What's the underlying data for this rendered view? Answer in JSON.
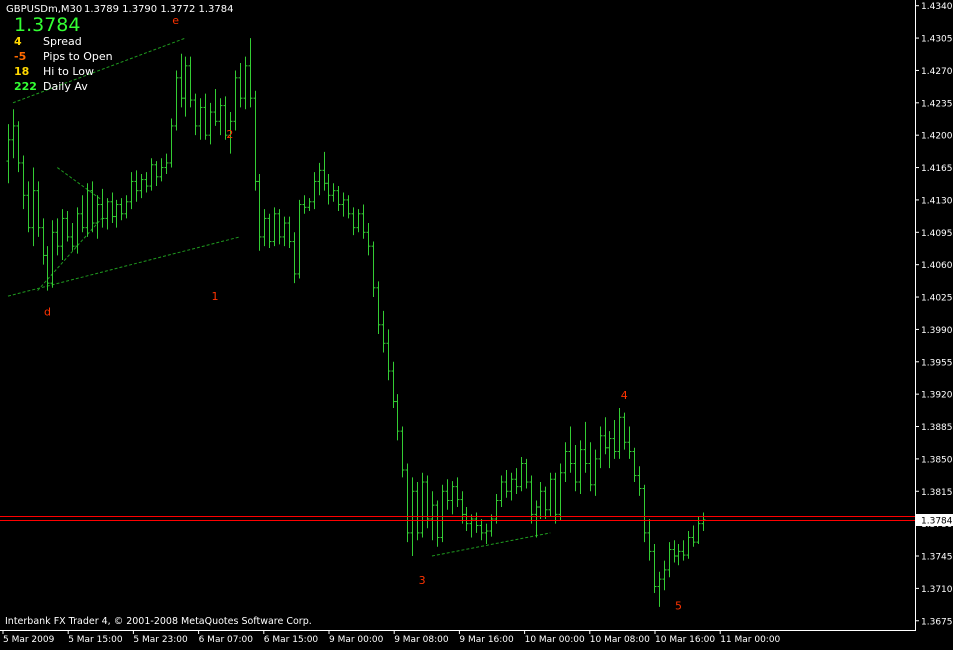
{
  "header": {
    "symbol_line": "GBPUSDm,M30",
    "ohlc": "1.3789 1.3790 1.3772 1.3784"
  },
  "info_panel": {
    "price": "1.3784",
    "rows": [
      {
        "value": "4",
        "label": "Spread",
        "color": "#ffd700"
      },
      {
        "value": "-5",
        "label": "Pips to Open",
        "color": "#ff6a00"
      },
      {
        "value": "18",
        "label": "Hi to Low",
        "color": "#ffd700"
      },
      {
        "value": "222",
        "label": "Daily Av",
        "color": "#33ff33"
      }
    ]
  },
  "copyright": "Interbank FX Trader 4, © 2001-2008 MetaQuotes Software Corp.",
  "colors": {
    "background": "#000000",
    "bars": "#33cc33",
    "axis": "#ffffff",
    "current_price_line": "#ff0000",
    "trendlines": "#1f9a1f",
    "wave_labels": "#ff3300",
    "price_big": "#33ff33"
  },
  "chart_data": {
    "type": "ohlc",
    "symbol": "GBPUSDm",
    "timeframe": "M30",
    "y_ticks": [
      "1.4340",
      "1.4305",
      "1.4270",
      "1.4235",
      "1.4200",
      "1.4165",
      "1.4130",
      "1.4095",
      "1.4060",
      "1.4025",
      "1.3990",
      "1.3955",
      "1.3920",
      "1.3885",
      "1.3850",
      "1.3815",
      "1.3780",
      "1.3745",
      "1.3710",
      "1.3675"
    ],
    "ylim": [
      1.3665,
      1.4344
    ],
    "x_ticks": [
      "5 Mar 2009",
      "5 Mar 15:00",
      "5 Mar 23:00",
      "6 Mar 07:00",
      "6 Mar 15:00",
      "9 Mar 00:00",
      "9 Mar 08:00",
      "9 Mar 16:00",
      "10 Mar 00:00",
      "10 Mar 08:00",
      "10 Mar 16:00",
      "11 Mar 00:00"
    ],
    "current_price": 1.3784,
    "current_price_label": "1.3784",
    "bars": [
      {
        "o": 1.4172,
        "h": 1.4212,
        "l": 1.4148,
        "c": 1.4195
      },
      {
        "o": 1.4195,
        "h": 1.4228,
        "l": 1.4175,
        "c": 1.421
      },
      {
        "o": 1.421,
        "h": 1.4215,
        "l": 1.416,
        "c": 1.417
      },
      {
        "o": 1.417,
        "h": 1.4178,
        "l": 1.412,
        "c": 1.4135
      },
      {
        "o": 1.4135,
        "h": 1.415,
        "l": 1.4095,
        "c": 1.41
      },
      {
        "o": 1.41,
        "h": 1.4165,
        "l": 1.408,
        "c": 1.414
      },
      {
        "o": 1.414,
        "h": 1.415,
        "l": 1.409,
        "c": 1.41
      },
      {
        "o": 1.41,
        "h": 1.411,
        "l": 1.406,
        "c": 1.407
      },
      {
        "o": 1.407,
        "h": 1.408,
        "l": 1.4032,
        "c": 1.404
      },
      {
        "o": 1.404,
        "h": 1.4108,
        "l": 1.4035,
        "c": 1.4095
      },
      {
        "o": 1.4095,
        "h": 1.411,
        "l": 1.407,
        "c": 1.408
      },
      {
        "o": 1.408,
        "h": 1.412,
        "l": 1.4065,
        "c": 1.411
      },
      {
        "o": 1.411,
        "h": 1.4118,
        "l": 1.4085,
        "c": 1.409
      },
      {
        "o": 1.409,
        "h": 1.4105,
        "l": 1.4075,
        "c": 1.408
      },
      {
        "o": 1.408,
        "h": 1.4122,
        "l": 1.4072,
        "c": 1.4115
      },
      {
        "o": 1.4115,
        "h": 1.4135,
        "l": 1.4095,
        "c": 1.41
      },
      {
        "o": 1.41,
        "h": 1.4148,
        "l": 1.409,
        "c": 1.414
      },
      {
        "o": 1.414,
        "h": 1.415,
        "l": 1.4095,
        "c": 1.4105
      },
      {
        "o": 1.4105,
        "h": 1.4135,
        "l": 1.4088,
        "c": 1.4125
      },
      {
        "o": 1.4125,
        "h": 1.4142,
        "l": 1.41,
        "c": 1.411
      },
      {
        "o": 1.411,
        "h": 1.4132,
        "l": 1.4098,
        "c": 1.4128
      },
      {
        "o": 1.4128,
        "h": 1.4138,
        "l": 1.4105,
        "c": 1.4112
      },
      {
        "o": 1.4112,
        "h": 1.413,
        "l": 1.41,
        "c": 1.4125
      },
      {
        "o": 1.4125,
        "h": 1.4132,
        "l": 1.4108,
        "c": 1.4115
      },
      {
        "o": 1.4115,
        "h": 1.4135,
        "l": 1.411,
        "c": 1.4128
      },
      {
        "o": 1.4128,
        "h": 1.416,
        "l": 1.412,
        "c": 1.415
      },
      {
        "o": 1.415,
        "h": 1.4162,
        "l": 1.4128,
        "c": 1.414
      },
      {
        "o": 1.414,
        "h": 1.4158,
        "l": 1.4132,
        "c": 1.4152
      },
      {
        "o": 1.4152,
        "h": 1.416,
        "l": 1.4138,
        "c": 1.4145
      },
      {
        "o": 1.4145,
        "h": 1.4175,
        "l": 1.414,
        "c": 1.4168
      },
      {
        "o": 1.4168,
        "h": 1.4172,
        "l": 1.4145,
        "c": 1.4155
      },
      {
        "o": 1.4155,
        "h": 1.4175,
        "l": 1.415,
        "c": 1.4165
      },
      {
        "o": 1.4165,
        "h": 1.418,
        "l": 1.4158,
        "c": 1.417
      },
      {
        "o": 1.417,
        "h": 1.4218,
        "l": 1.4165,
        "c": 1.421
      },
      {
        "o": 1.421,
        "h": 1.427,
        "l": 1.4205,
        "c": 1.4262
      },
      {
        "o": 1.4262,
        "h": 1.4288,
        "l": 1.423,
        "c": 1.424
      },
      {
        "o": 1.424,
        "h": 1.4285,
        "l": 1.422,
        "c": 1.4275
      },
      {
        "o": 1.4275,
        "h": 1.4285,
        "l": 1.423,
        "c": 1.4238
      },
      {
        "o": 1.4238,
        "h": 1.4245,
        "l": 1.42,
        "c": 1.421
      },
      {
        "o": 1.421,
        "h": 1.424,
        "l": 1.4195,
        "c": 1.423
      },
      {
        "o": 1.423,
        "h": 1.4245,
        "l": 1.4195,
        "c": 1.42
      },
      {
        "o": 1.42,
        "h": 1.4235,
        "l": 1.419,
        "c": 1.4225
      },
      {
        "o": 1.4225,
        "h": 1.425,
        "l": 1.421,
        "c": 1.4215
      },
      {
        "o": 1.4215,
        "h": 1.424,
        "l": 1.42,
        "c": 1.4232
      },
      {
        "o": 1.4232,
        "h": 1.4242,
        "l": 1.4195,
        "c": 1.42
      },
      {
        "o": 1.42,
        "h": 1.4225,
        "l": 1.418,
        "c": 1.4215
      },
      {
        "o": 1.4215,
        "h": 1.427,
        "l": 1.4205,
        "c": 1.4262
      },
      {
        "o": 1.4262,
        "h": 1.4278,
        "l": 1.423,
        "c": 1.424
      },
      {
        "o": 1.424,
        "h": 1.4285,
        "l": 1.4228,
        "c": 1.4275
      },
      {
        "o": 1.4275,
        "h": 1.4305,
        "l": 1.423,
        "c": 1.424
      },
      {
        "o": 1.424,
        "h": 1.4248,
        "l": 1.414,
        "c": 1.415
      },
      {
        "o": 1.415,
        "h": 1.4158,
        "l": 1.4075,
        "c": 1.409
      },
      {
        "o": 1.409,
        "h": 1.412,
        "l": 1.408,
        "c": 1.411
      },
      {
        "o": 1.411,
        "h": 1.4115,
        "l": 1.4078,
        "c": 1.4085
      },
      {
        "o": 1.4085,
        "h": 1.4122,
        "l": 1.408,
        "c": 1.4115
      },
      {
        "o": 1.4115,
        "h": 1.412,
        "l": 1.4082,
        "c": 1.409
      },
      {
        "o": 1.409,
        "h": 1.4112,
        "l": 1.408,
        "c": 1.4105
      },
      {
        "o": 1.4105,
        "h": 1.4112,
        "l": 1.4078,
        "c": 1.4085
      },
      {
        "o": 1.4085,
        "h": 1.4095,
        "l": 1.404,
        "c": 1.405
      },
      {
        "o": 1.405,
        "h": 1.413,
        "l": 1.4045,
        "c": 1.4125
      },
      {
        "o": 1.4125,
        "h": 1.4135,
        "l": 1.4115,
        "c": 1.4122
      },
      {
        "o": 1.4122,
        "h": 1.4132,
        "l": 1.4118,
        "c": 1.4128
      },
      {
        "o": 1.4128,
        "h": 1.416,
        "l": 1.412,
        "c": 1.415
      },
      {
        "o": 1.415,
        "h": 1.417,
        "l": 1.4135,
        "c": 1.4162
      },
      {
        "o": 1.4162,
        "h": 1.4182,
        "l": 1.414,
        "c": 1.4148
      },
      {
        "o": 1.4148,
        "h": 1.4158,
        "l": 1.4125,
        "c": 1.4135
      },
      {
        "o": 1.4135,
        "h": 1.4148,
        "l": 1.4128,
        "c": 1.414
      },
      {
        "o": 1.414,
        "h": 1.4145,
        "l": 1.4118,
        "c": 1.4125
      },
      {
        "o": 1.4125,
        "h": 1.4138,
        "l": 1.4112,
        "c": 1.413
      },
      {
        "o": 1.413,
        "h": 1.4135,
        "l": 1.411,
        "c": 1.4115
      },
      {
        "o": 1.4115,
        "h": 1.4122,
        "l": 1.4092,
        "c": 1.41
      },
      {
        "o": 1.41,
        "h": 1.412,
        "l": 1.4095,
        "c": 1.4115
      },
      {
        "o": 1.4115,
        "h": 1.4125,
        "l": 1.4088,
        "c": 1.4095
      },
      {
        "o": 1.4095,
        "h": 1.4105,
        "l": 1.407,
        "c": 1.408
      },
      {
        "o": 1.408,
        "h": 1.4085,
        "l": 1.4025,
        "c": 1.4035
      },
      {
        "o": 1.4035,
        "h": 1.4042,
        "l": 1.3985,
        "c": 1.3995
      },
      {
        "o": 1.3995,
        "h": 1.401,
        "l": 1.3965,
        "c": 1.3975
      },
      {
        "o": 1.3975,
        "h": 1.399,
        "l": 1.3935,
        "c": 1.3945
      },
      {
        "o": 1.3945,
        "h": 1.3955,
        "l": 1.3905,
        "c": 1.3912
      },
      {
        "o": 1.3912,
        "h": 1.392,
        "l": 1.387,
        "c": 1.388
      },
      {
        "o": 1.388,
        "h": 1.3885,
        "l": 1.383,
        "c": 1.3838
      },
      {
        "o": 1.3838,
        "h": 1.3845,
        "l": 1.376,
        "c": 1.377
      },
      {
        "o": 1.377,
        "h": 1.383,
        "l": 1.3745,
        "c": 1.3815
      },
      {
        "o": 1.3815,
        "h": 1.3825,
        "l": 1.3762,
        "c": 1.377
      },
      {
        "o": 1.377,
        "h": 1.3835,
        "l": 1.3765,
        "c": 1.3825
      },
      {
        "o": 1.3825,
        "h": 1.3832,
        "l": 1.3775,
        "c": 1.3785
      },
      {
        "o": 1.3785,
        "h": 1.3815,
        "l": 1.3762,
        "c": 1.38
      },
      {
        "o": 1.38,
        "h": 1.3805,
        "l": 1.3755,
        "c": 1.3765
      },
      {
        "o": 1.3765,
        "h": 1.3822,
        "l": 1.376,
        "c": 1.3815
      },
      {
        "o": 1.3815,
        "h": 1.3828,
        "l": 1.3795,
        "c": 1.3805
      },
      {
        "o": 1.3805,
        "h": 1.3826,
        "l": 1.379,
        "c": 1.382
      },
      {
        "o": 1.382,
        "h": 1.383,
        "l": 1.3798,
        "c": 1.3806
      },
      {
        "o": 1.3806,
        "h": 1.3815,
        "l": 1.378,
        "c": 1.379
      },
      {
        "o": 1.379,
        "h": 1.3798,
        "l": 1.3772,
        "c": 1.378
      },
      {
        "o": 1.378,
        "h": 1.379,
        "l": 1.3765,
        "c": 1.3785
      },
      {
        "o": 1.3785,
        "h": 1.3792,
        "l": 1.377,
        "c": 1.3778
      },
      {
        "o": 1.3778,
        "h": 1.3785,
        "l": 1.3762,
        "c": 1.377
      },
      {
        "o": 1.377,
        "h": 1.378,
        "l": 1.3758,
        "c": 1.3772
      },
      {
        "o": 1.3772,
        "h": 1.379,
        "l": 1.3766,
        "c": 1.3785
      },
      {
        "o": 1.3785,
        "h": 1.3812,
        "l": 1.378,
        "c": 1.3805
      },
      {
        "o": 1.3805,
        "h": 1.3832,
        "l": 1.3798,
        "c": 1.3825
      },
      {
        "o": 1.3825,
        "h": 1.3838,
        "l": 1.3808,
        "c": 1.3815
      },
      {
        "o": 1.3815,
        "h": 1.3835,
        "l": 1.3805,
        "c": 1.3828
      },
      {
        "o": 1.3828,
        "h": 1.384,
        "l": 1.3812,
        "c": 1.382
      },
      {
        "o": 1.382,
        "h": 1.3852,
        "l": 1.3815,
        "c": 1.3845
      },
      {
        "o": 1.3845,
        "h": 1.385,
        "l": 1.3818,
        "c": 1.3825
      },
      {
        "o": 1.3825,
        "h": 1.3832,
        "l": 1.378,
        "c": 1.379
      },
      {
        "o": 1.379,
        "h": 1.3805,
        "l": 1.3765,
        "c": 1.3798
      },
      {
        "o": 1.3798,
        "h": 1.3825,
        "l": 1.3785,
        "c": 1.3815
      },
      {
        "o": 1.3815,
        "h": 1.382,
        "l": 1.3785,
        "c": 1.3795
      },
      {
        "o": 1.3795,
        "h": 1.3835,
        "l": 1.3788,
        "c": 1.3828
      },
      {
        "o": 1.3828,
        "h": 1.3835,
        "l": 1.378,
        "c": 1.379
      },
      {
        "o": 1.379,
        "h": 1.3845,
        "l": 1.3784,
        "c": 1.3835
      },
      {
        "o": 1.3835,
        "h": 1.3868,
        "l": 1.3825,
        "c": 1.3858
      },
      {
        "o": 1.3858,
        "h": 1.3885,
        "l": 1.3835,
        "c": 1.3845
      },
      {
        "o": 1.3845,
        "h": 1.3865,
        "l": 1.3815,
        "c": 1.3825
      },
      {
        "o": 1.3825,
        "h": 1.387,
        "l": 1.3812,
        "c": 1.386
      },
      {
        "o": 1.386,
        "h": 1.389,
        "l": 1.3835,
        "c": 1.3845
      },
      {
        "o": 1.3845,
        "h": 1.3868,
        "l": 1.3815,
        "c": 1.3822
      },
      {
        "o": 1.3822,
        "h": 1.386,
        "l": 1.381,
        "c": 1.385
      },
      {
        "o": 1.385,
        "h": 1.3885,
        "l": 1.384,
        "c": 1.3875
      },
      {
        "o": 1.3875,
        "h": 1.3895,
        "l": 1.3855,
        "c": 1.3862
      },
      {
        "o": 1.3862,
        "h": 1.388,
        "l": 1.384,
        "c": 1.3872
      },
      {
        "o": 1.3872,
        "h": 1.3892,
        "l": 1.385,
        "c": 1.3858
      },
      {
        "o": 1.3858,
        "h": 1.3905,
        "l": 1.385,
        "c": 1.3895
      },
      {
        "o": 1.3895,
        "h": 1.39,
        "l": 1.386,
        "c": 1.3868
      },
      {
        "o": 1.3868,
        "h": 1.3885,
        "l": 1.385,
        "c": 1.3858
      },
      {
        "o": 1.3858,
        "h": 1.3862,
        "l": 1.3825,
        "c": 1.3832
      },
      {
        "o": 1.3832,
        "h": 1.3842,
        "l": 1.381,
        "c": 1.3818
      },
      {
        "o": 1.3818,
        "h": 1.3822,
        "l": 1.376,
        "c": 1.377
      },
      {
        "o": 1.377,
        "h": 1.3785,
        "l": 1.374,
        "c": 1.375
      },
      {
        "o": 1.375,
        "h": 1.3758,
        "l": 1.3705,
        "c": 1.3712
      },
      {
        "o": 1.3712,
        "h": 1.3728,
        "l": 1.369,
        "c": 1.372
      },
      {
        "o": 1.372,
        "h": 1.374,
        "l": 1.3708,
        "c": 1.373
      },
      {
        "o": 1.373,
        "h": 1.376,
        "l": 1.3722,
        "c": 1.3752
      },
      {
        "o": 1.3752,
        "h": 1.3762,
        "l": 1.3738,
        "c": 1.3745
      },
      {
        "o": 1.3745,
        "h": 1.3758,
        "l": 1.3735,
        "c": 1.375
      },
      {
        "o": 1.375,
        "h": 1.3762,
        "l": 1.374,
        "c": 1.3746
      },
      {
        "o": 1.3746,
        "h": 1.3772,
        "l": 1.3742,
        "c": 1.3765
      },
      {
        "o": 1.3765,
        "h": 1.3778,
        "l": 1.3755,
        "c": 1.376
      },
      {
        "o": 1.376,
        "h": 1.3788,
        "l": 1.3758,
        "c": 1.378
      },
      {
        "o": 1.378,
        "h": 1.3792,
        "l": 1.3772,
        "c": 1.3784
      }
    ],
    "trendlines": [
      {
        "from": [
          0,
          1.4026
        ],
        "to": [
          47,
          1.409
        ]
      },
      {
        "from": [
          1,
          1.4235
        ],
        "to": [
          36,
          1.4305
        ]
      },
      {
        "from": [
          6,
          1.4032
        ],
        "to": [
          19,
          1.411
        ]
      },
      {
        "from": [
          10,
          1.4165
        ],
        "to": [
          19,
          1.413
        ]
      },
      {
        "from": [
          86,
          1.3745
        ],
        "to": [
          110,
          1.377
        ]
      }
    ],
    "wave_labels": [
      {
        "text": "e",
        "bar": 34,
        "price": 1.432
      },
      {
        "text": "d",
        "bar": 8,
        "price": 1.4005
      },
      {
        "text": "2",
        "bar": 45,
        "price": 1.4197
      },
      {
        "text": "1",
        "bar": 42,
        "price": 1.4022
      },
      {
        "text": "3",
        "bar": 84,
        "price": 1.3715
      },
      {
        "text": "4",
        "bar": 125,
        "price": 1.3915
      },
      {
        "text": "5",
        "bar": 136,
        "price": 1.3687
      }
    ]
  }
}
